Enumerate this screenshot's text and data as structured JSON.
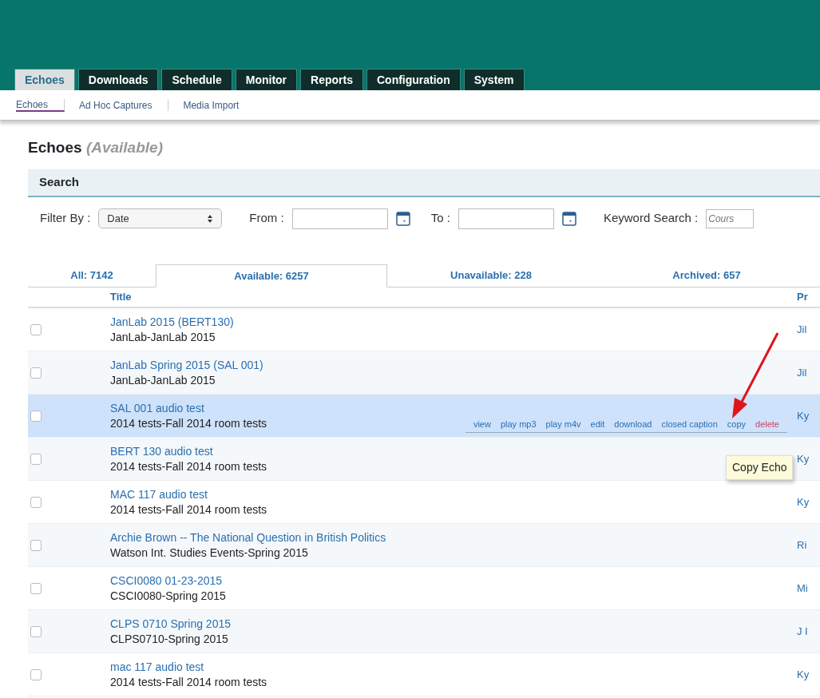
{
  "main_tabs": [
    {
      "label": "Echoes",
      "selected": true
    },
    {
      "label": "Downloads",
      "selected": false
    },
    {
      "label": "Schedule",
      "selected": false
    },
    {
      "label": "Monitor",
      "selected": false
    },
    {
      "label": "Reports",
      "selected": false
    },
    {
      "label": "Configuration",
      "selected": false
    },
    {
      "label": "System",
      "selected": false
    }
  ],
  "sub_tabs": [
    {
      "label": "Echoes",
      "selected": true
    },
    {
      "label": "Ad Hoc Captures",
      "selected": false
    },
    {
      "label": "Media Import",
      "selected": false
    }
  ],
  "page_title": {
    "title": "Echoes",
    "qualifier": "(Available)"
  },
  "search": {
    "heading": "Search",
    "filter_label": "Filter By :",
    "filter_value": "Date",
    "from_label": "From :",
    "to_label": "To :",
    "keyword_label": "Keyword Search :",
    "keyword_placeholder": "Cours"
  },
  "status_tabs": [
    {
      "label": "All: 7142",
      "selected": false
    },
    {
      "label": "Available: 6257",
      "selected": true
    },
    {
      "label": "Unavailable: 228",
      "selected": false
    },
    {
      "label": "Archived: 657",
      "selected": false
    }
  ],
  "table": {
    "columns": [
      "Title",
      "Pr"
    ],
    "rows": [
      {
        "title": "JanLab 2015 (BERT130)",
        "subtitle": "JanLab-JanLab 2015",
        "column_2": "Jil",
        "checked": false,
        "selected": false
      },
      {
        "title": "JanLab Spring 2015 (SAL 001)",
        "subtitle": "JanLab-JanLab 2015",
        "column_2": "Jil",
        "checked": false,
        "selected": false
      },
      {
        "title": "SAL 001 audio test",
        "subtitle": "2014 tests-Fall 2014 room tests",
        "column_2": "Ky",
        "checked": false,
        "selected": true,
        "actions": [
          {
            "label": "view",
            "kind": "link"
          },
          {
            "label": "play mp3",
            "kind": "link"
          },
          {
            "label": "play m4v",
            "kind": "link"
          },
          {
            "label": "edit",
            "kind": "link"
          },
          {
            "label": "download",
            "kind": "link"
          },
          {
            "label": "closed caption",
            "kind": "link"
          },
          {
            "label": "copy",
            "kind": "link"
          },
          {
            "label": "delete",
            "kind": "danger"
          }
        ]
      },
      {
        "title": "BERT 130 audio test",
        "subtitle": "2014 tests-Fall 2014 room tests",
        "column_2": "Ky",
        "checked": false,
        "selected": false
      },
      {
        "title": "MAC 117 audio test",
        "subtitle": "2014 tests-Fall 2014 room tests",
        "column_2": "Ky",
        "checked": false,
        "selected": false
      },
      {
        "title": "Archie Brown -- The National Question in British Politics",
        "subtitle": "Watson Int. Studies Events-Spring 2015",
        "column_2": "Ri",
        "checked": false,
        "selected": false
      },
      {
        "title": "CSCI0080 01-23-2015",
        "subtitle": "CSCI0080-Spring 2015",
        "column_2": "Mi",
        "checked": false,
        "selected": false
      },
      {
        "title": "CLPS 0710 Spring 2015",
        "subtitle": "CLPS0710-Spring 2015",
        "column_2": "J I",
        "checked": false,
        "selected": false
      },
      {
        "title": "mac 117 audio test",
        "subtitle": "2014 tests-Fall 2014 room tests",
        "column_2": "Ky",
        "checked": false,
        "selected": false
      }
    ]
  },
  "tooltip": "Copy Echo"
}
